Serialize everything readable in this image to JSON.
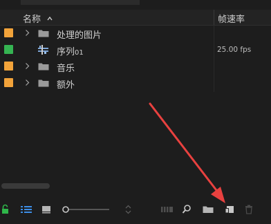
{
  "header": {
    "name_label": "名称",
    "fps_label": "帧速率"
  },
  "rows": [
    {
      "label": "处理的图片",
      "type": "bin",
      "color": "#f2a33a"
    },
    {
      "label": "序列",
      "label_suffix": "01",
      "type": "sequence",
      "color": "#35b452",
      "rate": "25.00 fps"
    },
    {
      "label": "音乐",
      "type": "bin",
      "color": "#f2a33a"
    },
    {
      "label": "额外",
      "type": "bin",
      "color": "#f2a33a"
    }
  ],
  "icons": {
    "lock": "lock-icon",
    "list_view": "list-view-icon",
    "icon_view": "icon-view-icon",
    "zoom_slider": "zoom-slider",
    "sort": "sort-icon",
    "automate": "automate-to-sequence-icon",
    "find": "find-icon",
    "new_bin": "new-bin-icon",
    "new_item": "new-item-icon",
    "clear": "trash-icon"
  },
  "colors": {
    "accent_blue": "#3d8fe8",
    "lock_green": "#2fb64a",
    "annotation_red": "#e8413f"
  }
}
